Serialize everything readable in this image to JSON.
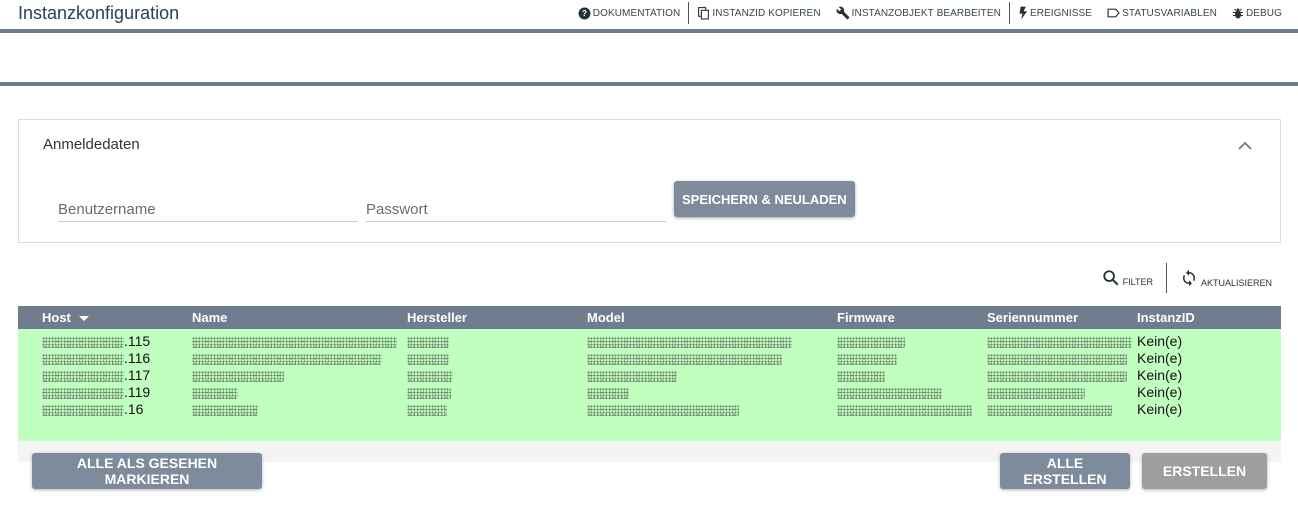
{
  "header": {
    "title": "Instanzkonfiguration",
    "toolbar": {
      "documentation": "DOKUMENTATION",
      "copy_id": "INSTANZID KOPIEREN",
      "edit_object": "INSTANZOBJEKT BEARBEITEN",
      "events": "EREIGNISSE",
      "status_variables": "STATUSVARIABLEN",
      "debug": "DEBUG"
    }
  },
  "credentials": {
    "title": "Anmeldedaten",
    "username_placeholder": "Benutzername",
    "password_placeholder": "Passwort",
    "save_button": "SPEICHERN & NEULADEN"
  },
  "list_actions": {
    "filter": "FILTER",
    "refresh": "AKTUALISIEREN"
  },
  "table": {
    "columns": [
      "Host",
      "Name",
      "Hersteller",
      "Model",
      "Firmware",
      "Seriennummer",
      "InstanzID"
    ],
    "sort_column": "Host",
    "row_color": "#c1ffc1",
    "rows": [
      {
        "host_suffix": ".115",
        "instance_id": "Kein(e)"
      },
      {
        "host_suffix": ".116",
        "instance_id": "Kein(e)"
      },
      {
        "host_suffix": ".117",
        "instance_id": "Kein(e)"
      },
      {
        "host_suffix": ".119",
        "instance_id": "Kein(e)"
      },
      {
        "host_suffix": ".16",
        "instance_id": "Kein(e)"
      }
    ]
  },
  "footer": {
    "mark_all_seen": "ALLE ALS GESEHEN MARKIEREN",
    "create_all": "ALLE ERSTELLEN",
    "create": "ERSTELLEN"
  },
  "colors": {
    "header_bar": "#6c7a89",
    "button_primary": "#7d8b9c",
    "button_disabled": "#9e9e9e",
    "table_header": "#6f7d8f"
  }
}
